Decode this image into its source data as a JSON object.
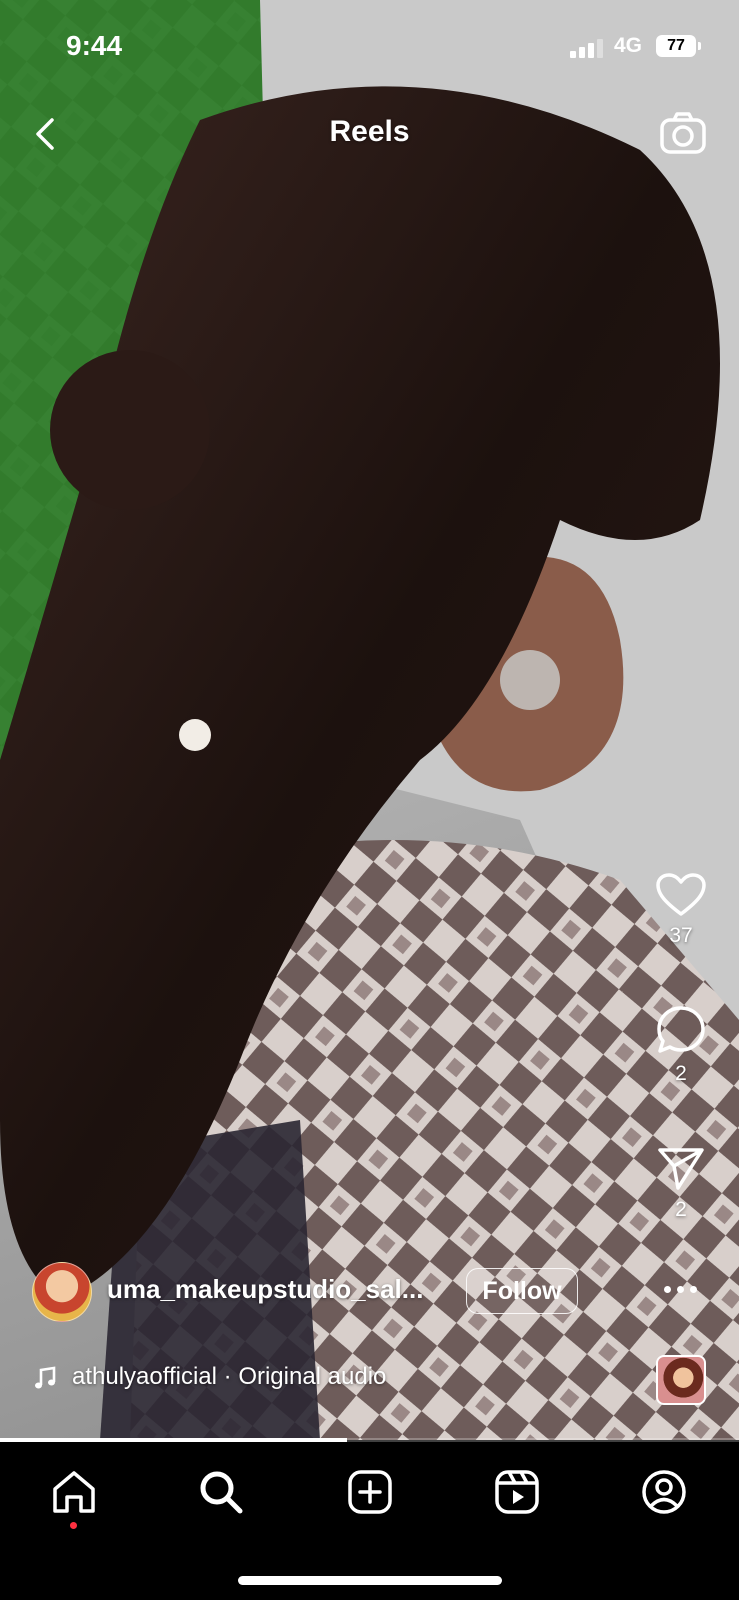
{
  "status_bar": {
    "time": "9:44",
    "network": "4G",
    "battery": "77"
  },
  "header": {
    "title": "Reels"
  },
  "actions": {
    "likes": "37",
    "comments": "2",
    "shares": "2"
  },
  "post": {
    "username": "uma_makeupstudio_sal...",
    "follow_label": "Follow",
    "audio": "athulyaofficial · Original audio"
  },
  "progress": 0.47,
  "colors": {
    "notification_dot": "#ff3040",
    "background": "#000000"
  }
}
